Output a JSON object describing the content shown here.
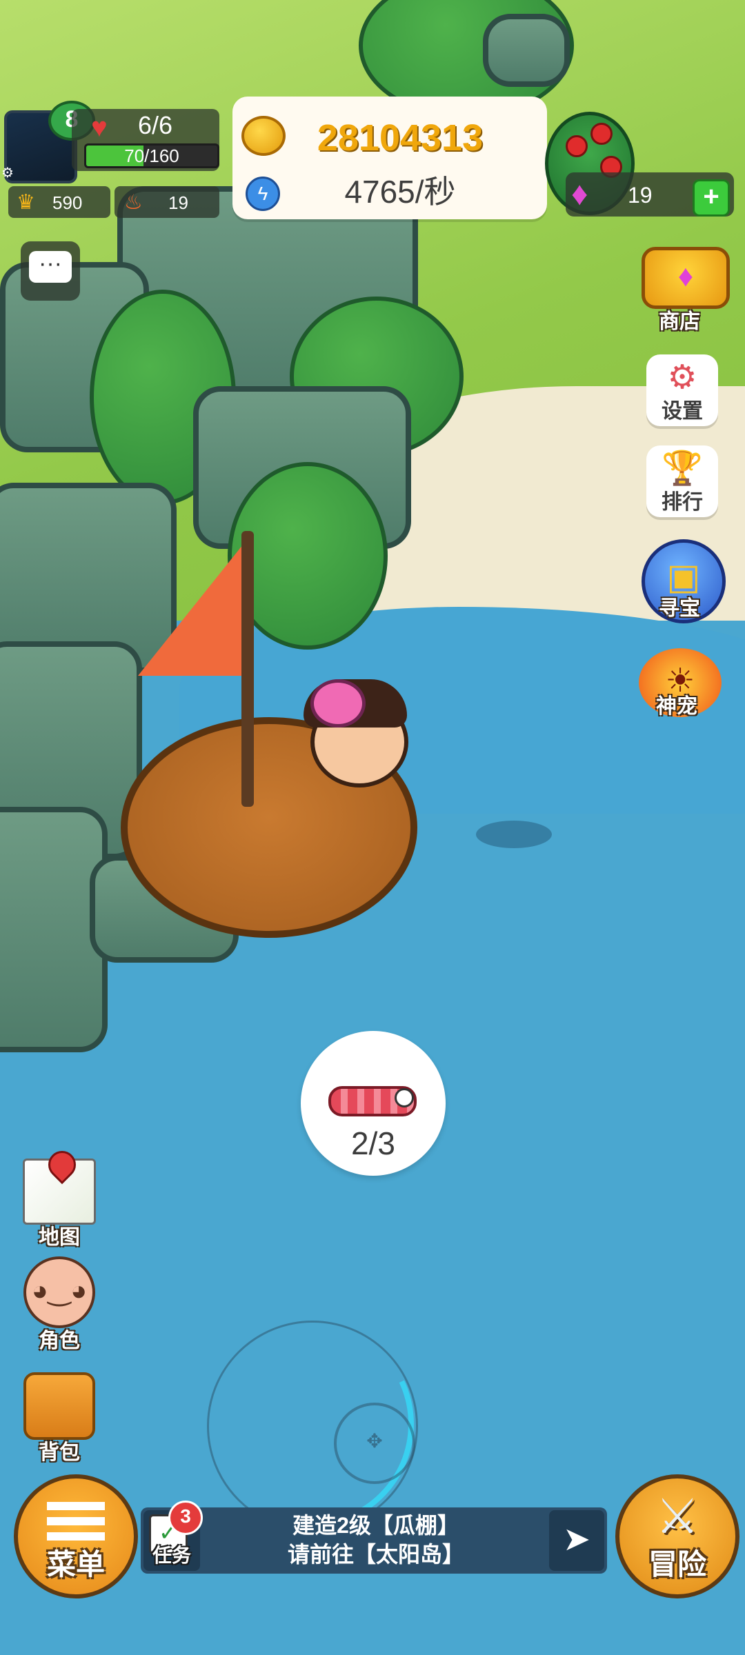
{
  "player": {
    "level": "8",
    "hp": "6/6",
    "xp_text": "70/160",
    "xp_fraction": 0.4375,
    "crowns": "590",
    "fire": "19"
  },
  "currency": {
    "gold": "28104313",
    "rate": "4765/秒"
  },
  "gems": {
    "count": "19",
    "plus": "+"
  },
  "right_menu": {
    "shop": "商店",
    "settings": "设置",
    "ranking": "排行",
    "treasure": "寻宝",
    "pet": "神宠"
  },
  "bait": {
    "count": "2/3"
  },
  "left_menu": {
    "map": "地图",
    "role": "角色",
    "bag": "背包"
  },
  "bottom": {
    "menu": "菜单",
    "task_label": "任务",
    "task_badge": "3",
    "task_line1": "建造2级【瓜棚】",
    "task_line2": "请前往【太阳岛】",
    "adventure": "冒险"
  },
  "icons": {
    "heart": "heart-icon",
    "crown": "crown-icon",
    "fire": "fire-icon",
    "coin": "coin-icon",
    "energy": "lightning-icon",
    "gem": "gem-icon",
    "chat": "chat-icon"
  },
  "colors": {
    "water": "#4aa7d0",
    "grass": "#93c94a",
    "gold_text": "#f0a70c",
    "xp_fill": "#4cc43c"
  }
}
